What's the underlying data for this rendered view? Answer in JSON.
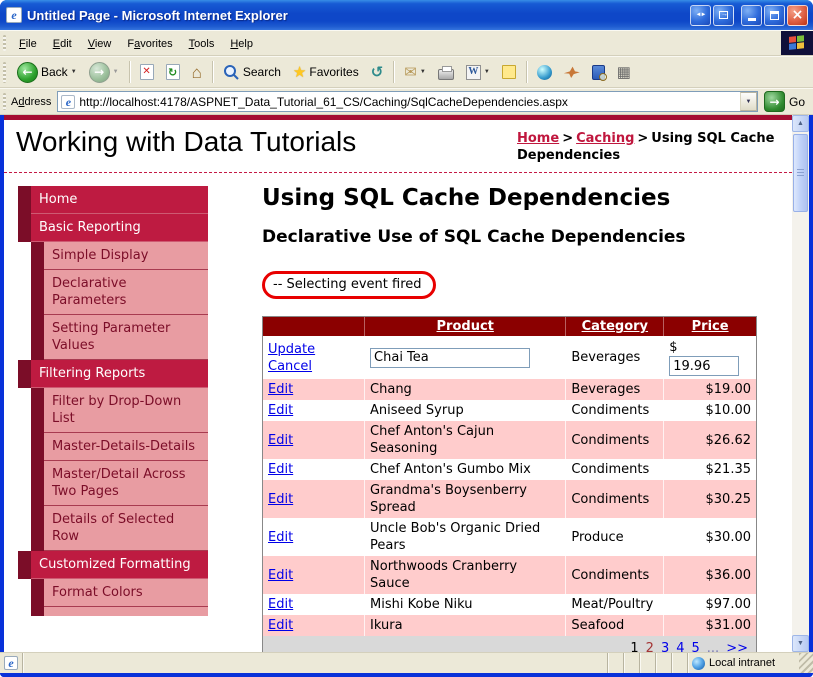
{
  "window": {
    "title": "Untitled Page - Microsoft Internet Explorer"
  },
  "menu_bar": {
    "items": [
      {
        "pre": "",
        "key": "F",
        "post": "ile"
      },
      {
        "pre": "",
        "key": "E",
        "post": "dit"
      },
      {
        "pre": "",
        "key": "V",
        "post": "iew"
      },
      {
        "pre": "F",
        "key": "a",
        "post": "vorites"
      },
      {
        "pre": "",
        "key": "T",
        "post": "ools"
      },
      {
        "pre": "",
        "key": "H",
        "post": "elp"
      }
    ]
  },
  "toolbar": {
    "back_label": "Back",
    "search_label": "Search",
    "favorites_label": "Favorites"
  },
  "address_bar": {
    "label_pre": "A",
    "label_key": "d",
    "label_post": "dress",
    "url": "http://localhost:4178/ASPNET_Data_Tutorial_61_CS/Caching/SqlCacheDependencies.aspx",
    "go_label": "Go"
  },
  "icons": {
    "word_glyph": "W",
    "ie_glyph": "e"
  },
  "page": {
    "site_title": "Working with Data Tutorials",
    "breadcrumb": {
      "links": [
        {
          "label": "Home"
        },
        {
          "label": "Caching"
        }
      ],
      "separator": ">",
      "current": "Using SQL Cache Dependencies"
    },
    "sidebar": {
      "items": [
        {
          "label": "Home",
          "level": "top"
        },
        {
          "label": "Basic Reporting",
          "level": "top"
        },
        {
          "label": "Simple Display",
          "level": "sub"
        },
        {
          "label": "Declarative Parameters",
          "level": "sub"
        },
        {
          "label": "Setting Parameter Values",
          "level": "sub"
        },
        {
          "label": "Filtering Reports",
          "level": "top"
        },
        {
          "label": "Filter by Drop-Down List",
          "level": "sub"
        },
        {
          "label": "Master-Details-Details",
          "level": "sub"
        },
        {
          "label": "Master/Detail Across Two Pages",
          "level": "sub"
        },
        {
          "label": "Details of Selected Row",
          "level": "sub"
        },
        {
          "label": "Customized Formatting",
          "level": "top"
        },
        {
          "label": "Format Colors",
          "level": "sub"
        }
      ]
    },
    "main": {
      "heading": "Using SQL Cache Dependencies",
      "subheading": "Declarative Use of SQL Cache Dependencies",
      "event_message": "-- Selecting event fired",
      "grid": {
        "columns": [
          "",
          "Product",
          "Category",
          "Price"
        ],
        "edit_row": {
          "update_label": "Update",
          "cancel_label": "Cancel",
          "product_value": "Chai Tea",
          "category": "Beverages",
          "currency": "$",
          "price_value": "19.96"
        },
        "rows": [
          {
            "action": "Edit",
            "product": "Chang",
            "category": "Beverages",
            "price": "$19.00",
            "shade": "pink"
          },
          {
            "action": "Edit",
            "product": "Aniseed Syrup",
            "category": "Condiments",
            "price": "$10.00",
            "shade": "white"
          },
          {
            "action": "Edit",
            "product": "Chef Anton's Cajun Seasoning",
            "category": "Condiments",
            "price": "$26.62",
            "shade": "pink"
          },
          {
            "action": "Edit",
            "product": "Chef Anton's Gumbo Mix",
            "category": "Condiments",
            "price": "$21.35",
            "shade": "white"
          },
          {
            "action": "Edit",
            "product": "Grandma's Boysenberry Spread",
            "category": "Condiments",
            "price": "$30.25",
            "shade": "pink"
          },
          {
            "action": "Edit",
            "product": "Uncle Bob's Organic Dried Pears",
            "category": "Produce",
            "price": "$30.00",
            "shade": "white"
          },
          {
            "action": "Edit",
            "product": "Northwoods Cranberry Sauce",
            "category": "Condiments",
            "price": "$36.00",
            "shade": "pink"
          },
          {
            "action": "Edit",
            "product": "Mishi Kobe Niku",
            "category": "Meat/Poultry",
            "price": "$97.00",
            "shade": "white"
          },
          {
            "action": "Edit",
            "product": "Ikura",
            "category": "Seafood",
            "price": "$31.00",
            "shade": "pink"
          }
        ],
        "pager": [
          {
            "label": "1",
            "type": "current"
          },
          {
            "label": "2",
            "type": "visited"
          },
          {
            "label": "3",
            "type": "link"
          },
          {
            "label": "4",
            "type": "link"
          },
          {
            "label": "5",
            "type": "link"
          },
          {
            "label": "...",
            "type": "more"
          },
          {
            "label": ">>",
            "type": "link"
          }
        ]
      }
    }
  },
  "status_bar": {
    "zone_label": "Local intranet"
  },
  "colors": {
    "crimson_accent": "#BE1B41",
    "maroon_dark": "#7B0D28",
    "table_header": "#8B0000",
    "row_pink": "#FFCCCC",
    "pager_gray": "#D9D9D9",
    "link_blue": "#0000E8",
    "visited_red": "#A33333",
    "annotation_red": "#E80000",
    "titlebar_blue": "#0E47C8"
  }
}
